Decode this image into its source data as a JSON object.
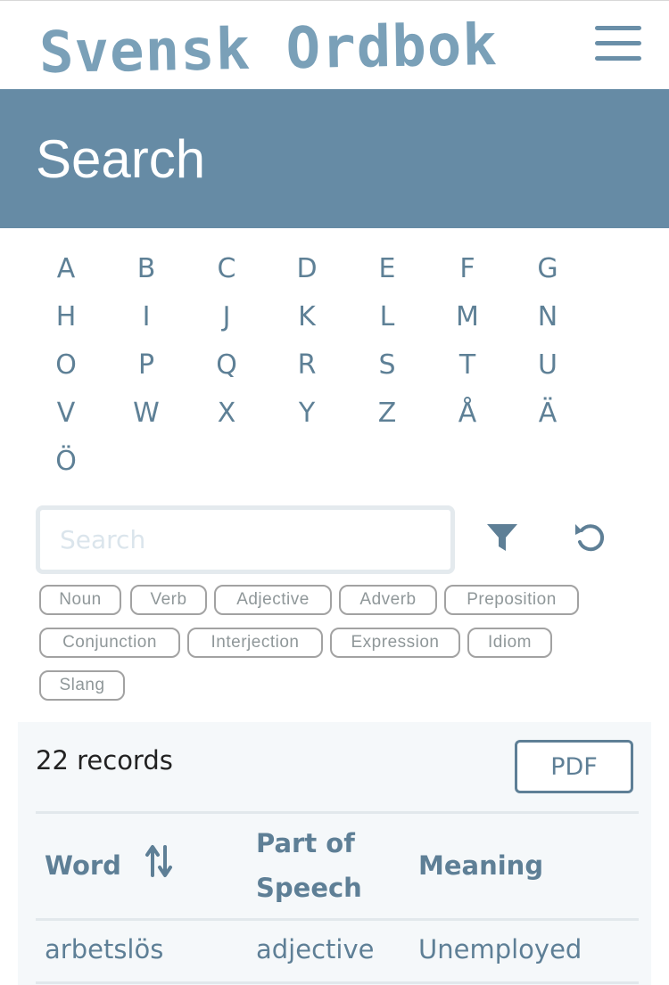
{
  "header": {
    "logo_text": "Svensk Ordbok",
    "menu_icon": "hamburger-menu-icon"
  },
  "hero": {
    "title": "Search"
  },
  "alphabet": [
    "A",
    "B",
    "C",
    "D",
    "E",
    "F",
    "G",
    "H",
    "I",
    "J",
    "K",
    "L",
    "M",
    "N",
    "O",
    "P",
    "Q",
    "R",
    "S",
    "T",
    "U",
    "V",
    "W",
    "X",
    "Y",
    "Z",
    "Å",
    "Ä",
    "Ö"
  ],
  "search": {
    "placeholder": "Search",
    "value": "",
    "filter_icon": "filter-funnel-icon",
    "reset_icon": "reset-undo-icon"
  },
  "tags": [
    "Noun",
    "Verb",
    "Adjective",
    "Adverb",
    "Preposition",
    "Conjunction",
    "Interjection",
    "Expression",
    "Idiom",
    "Slang"
  ],
  "results": {
    "count_label": "22 records",
    "pdf_label": "PDF",
    "columns": [
      "Word",
      "Part of",
      "Speech",
      "Meaning"
    ],
    "sort_icon": "sort-up-down-icon",
    "rows": [
      {
        "word": "arbetslös",
        "pos": "adjective",
        "meaning": "Unemployed"
      }
    ]
  },
  "colors": {
    "hero_bg": "#668ba5",
    "accent": "#5e7f96",
    "logo": "#7aa0b8",
    "results_bg": "#f5f8fa"
  }
}
